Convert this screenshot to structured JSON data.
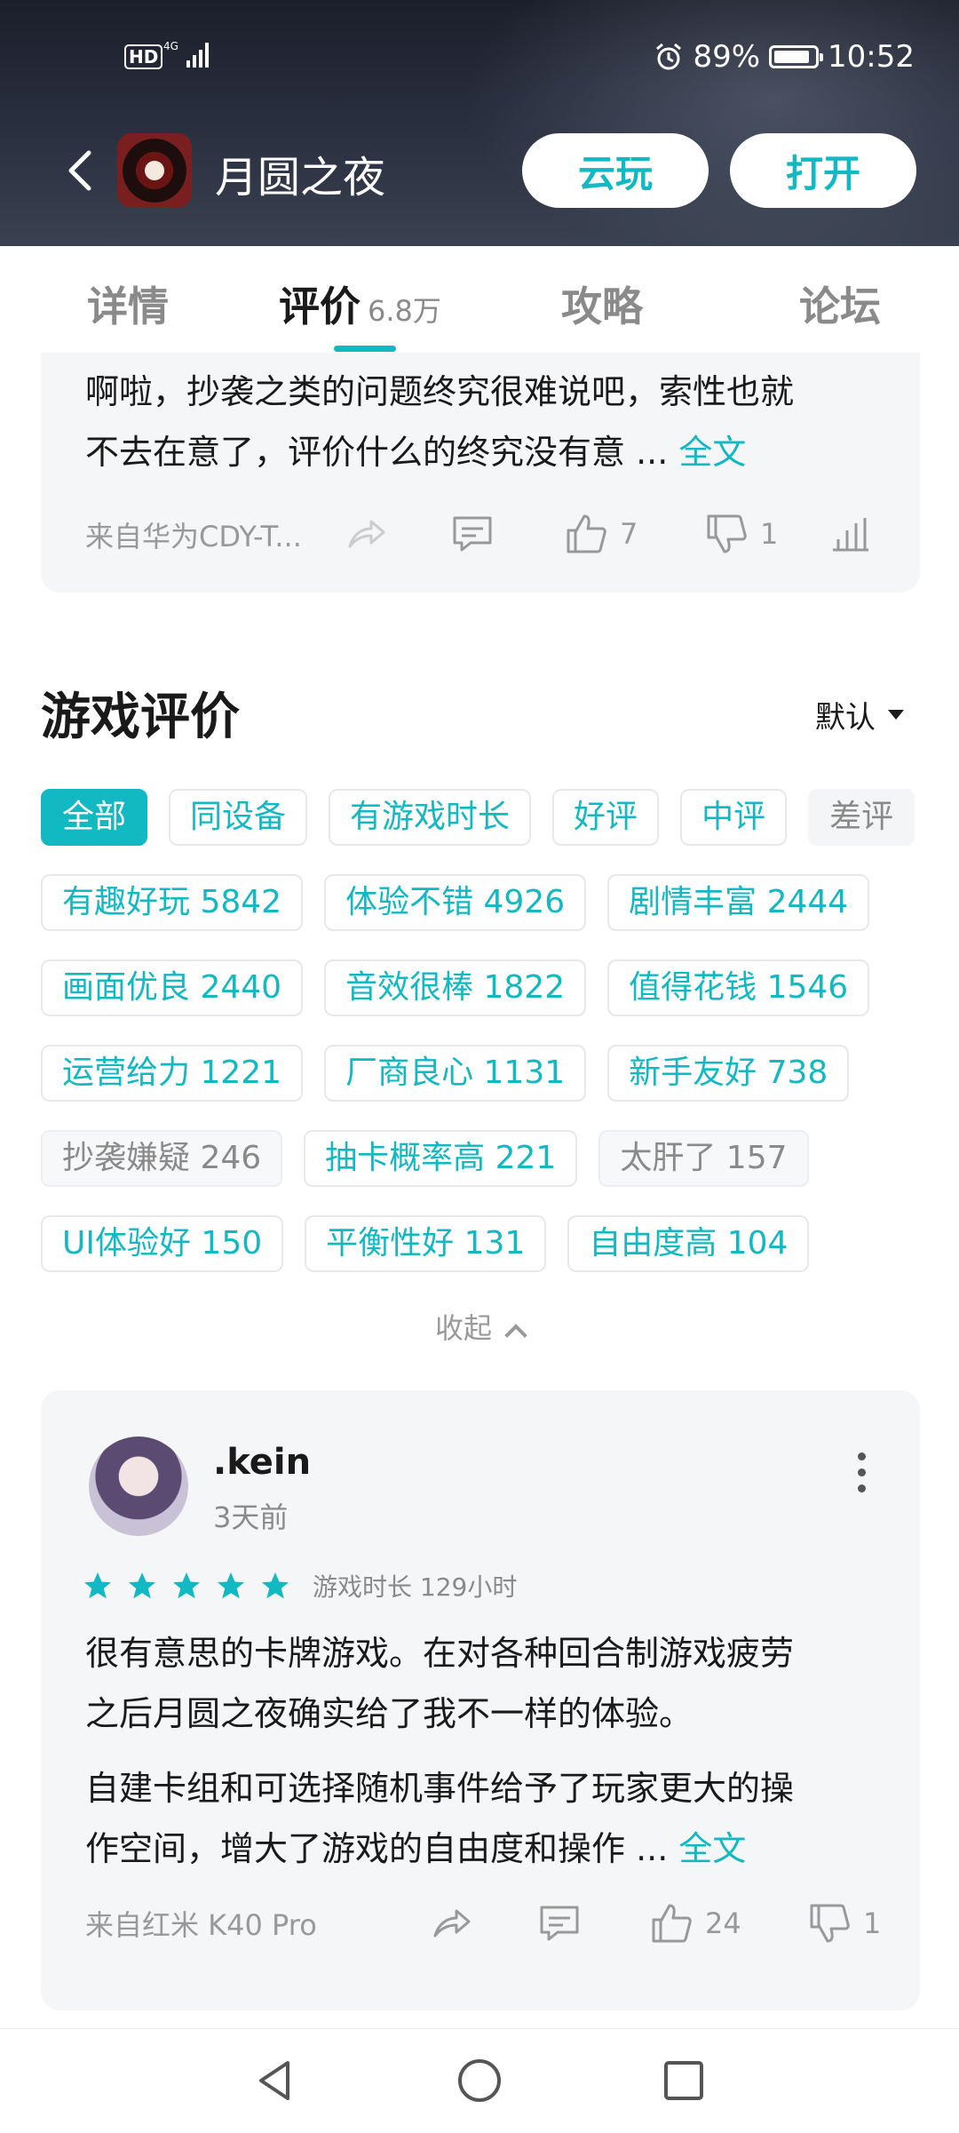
{
  "status": {
    "network": "4G",
    "hd": "HD",
    "battery": "89%",
    "battery_level": 0.89,
    "time": "10:52"
  },
  "header": {
    "app_name": "月圆之夜",
    "cloud_play": "云玩",
    "open": "打开"
  },
  "tabs": [
    {
      "label": "详情"
    },
    {
      "label": "评价",
      "count": "6.8万",
      "active": true
    },
    {
      "label": "攻略"
    },
    {
      "label": "论坛"
    }
  ],
  "prev_review": {
    "line1": "啊啦，抄袭之类的问题终究很难说吧，索性也就",
    "line2": "不去在意了，评价什么的终究没有意 ...",
    "more": "全文",
    "device": "来自华为CDY-T...",
    "likes": "7",
    "dislikes": "1"
  },
  "section": {
    "title": "游戏评价",
    "sort": "默认"
  },
  "filters": [
    {
      "label": "全部",
      "active": true
    },
    {
      "label": "同设备"
    },
    {
      "label": "有游戏时长"
    },
    {
      "label": "好评"
    },
    {
      "label": "中评"
    },
    {
      "label": "差评",
      "muted": true
    }
  ],
  "tags": [
    [
      {
        "label": "有趣好玩 5842"
      },
      {
        "label": "体验不错 4926"
      },
      {
        "label": "剧情丰富 2444"
      }
    ],
    [
      {
        "label": "画面优良 2440"
      },
      {
        "label": "音效很棒 1822"
      },
      {
        "label": "值得花钱 1546"
      }
    ],
    [
      {
        "label": "运营给力 1221"
      },
      {
        "label": "厂商良心 1131"
      },
      {
        "label": "新手友好 738"
      }
    ],
    [
      {
        "label": "抄袭嫌疑 246",
        "negative": true
      },
      {
        "label": "抽卡概率高 221"
      },
      {
        "label": "太肝了 157",
        "negative": true
      }
    ],
    [
      {
        "label": "UI体验好   150"
      },
      {
        "label": "平衡性好 131"
      },
      {
        "label": "自由度高 104"
      }
    ]
  ],
  "collapse": "收起",
  "review": {
    "user": ".kein",
    "time": "3天前",
    "rating": 5,
    "playtime": "游戏时长 129小时",
    "p1_line1": "很有意思的卡牌游戏。在对各种回合制游戏疲劳",
    "p1_line2": "之后月圆之夜确实给了我不一样的体验。",
    "p2_line1": "自建卡组和可选择随机事件给予了玩家更大的操",
    "p2_line2": "作空间，增大了游戏的自由度和操作 ...",
    "more": "全文",
    "device": "来自红米 K40 Pro",
    "likes": "24",
    "dislikes": "1"
  },
  "colors": {
    "accent": "#12b8c2",
    "card_bg": "#f5f6f8",
    "text": "#1a1a1a",
    "muted": "#999999"
  }
}
